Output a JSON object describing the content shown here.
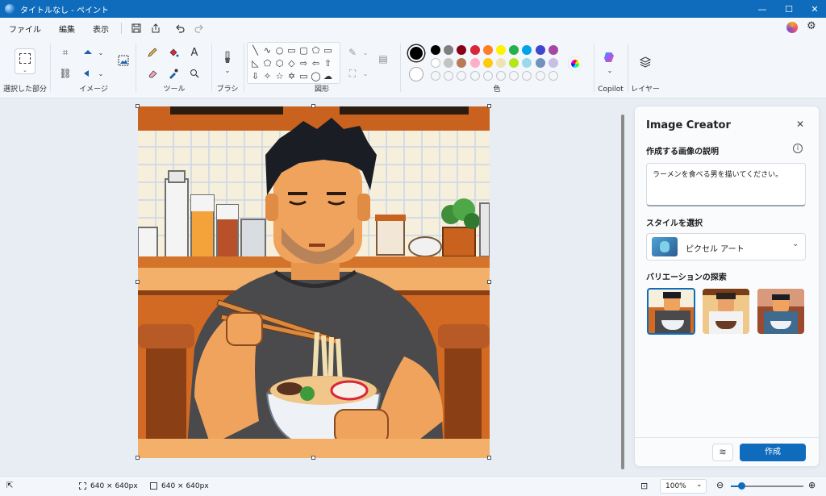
{
  "window": {
    "title": "タイトルなし - ペイント",
    "minimize": "—",
    "maximize": "☐",
    "close": "✕"
  },
  "menu": {
    "items": [
      "ファイル",
      "編集",
      "表示"
    ]
  },
  "ribbon": {
    "groups": {
      "selection": "選択した部分",
      "image": "イメージ",
      "tools": "ツール",
      "brushes": "ブラシ",
      "shapes": "図形",
      "colors": "色",
      "copilot": "Copilot",
      "layers": "レイヤー"
    },
    "colors": {
      "primary": "#000000",
      "secondary": "#ffffff",
      "row1": [
        "#000000",
        "#7f7f7f",
        "#880015",
        "#d9263a",
        "#ff7f27",
        "#fff200",
        "#22b14c",
        "#00a2e8",
        "#3f48cc",
        "#a349a4"
      ],
      "row2": [
        "#ffffff",
        "#c3c3c3",
        "#b97a57",
        "#ffaec9",
        "#ffc90e",
        "#efe4b0",
        "#b5e61d",
        "#99d9ea",
        "#7092be",
        "#c8bfe7"
      ]
    }
  },
  "panel": {
    "title": "Image Creator",
    "description_label": "作成する画像の説明",
    "prompt": "ラーメンを食べる男を描いてください。",
    "style_label": "スタイルを選択",
    "style_value": "ピクセル アート",
    "variations_label": "バリエーションの探索",
    "create_button": "作成"
  },
  "status": {
    "selection_size": "640 × 640px",
    "canvas_size": "640 × 640px",
    "zoom": "100%",
    "zoom_level": 0.14
  }
}
